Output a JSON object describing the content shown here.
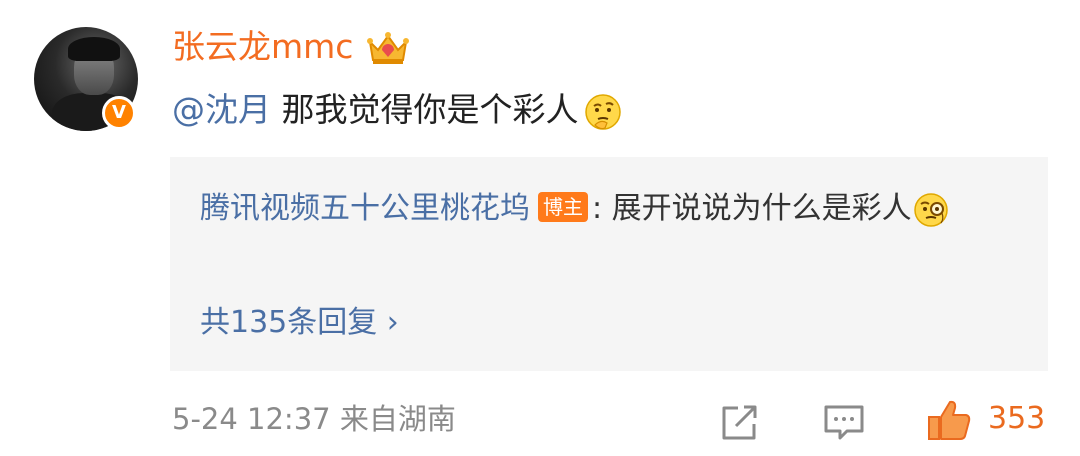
{
  "post": {
    "username": "张云龙mmc",
    "verified_badge": "V",
    "mention": "@沈月",
    "text": "那我觉得你是个彩人",
    "emoji_icon": "thinking-face-icon"
  },
  "reply": {
    "user": "腾讯视频五十公里桃花坞",
    "badge": "博主",
    "text": "展开说说为什么是彩人",
    "emoji_icon": "monocle-face-icon",
    "count_label": "共135条回复 ›"
  },
  "footer": {
    "time_location": "5-24 12:37 来自湖南",
    "like_count": "353"
  },
  "colors": {
    "username": "#f36c21",
    "link": "#4a6fa5",
    "like": "#ea6a1f",
    "reply_bg": "#f5f5f5"
  }
}
